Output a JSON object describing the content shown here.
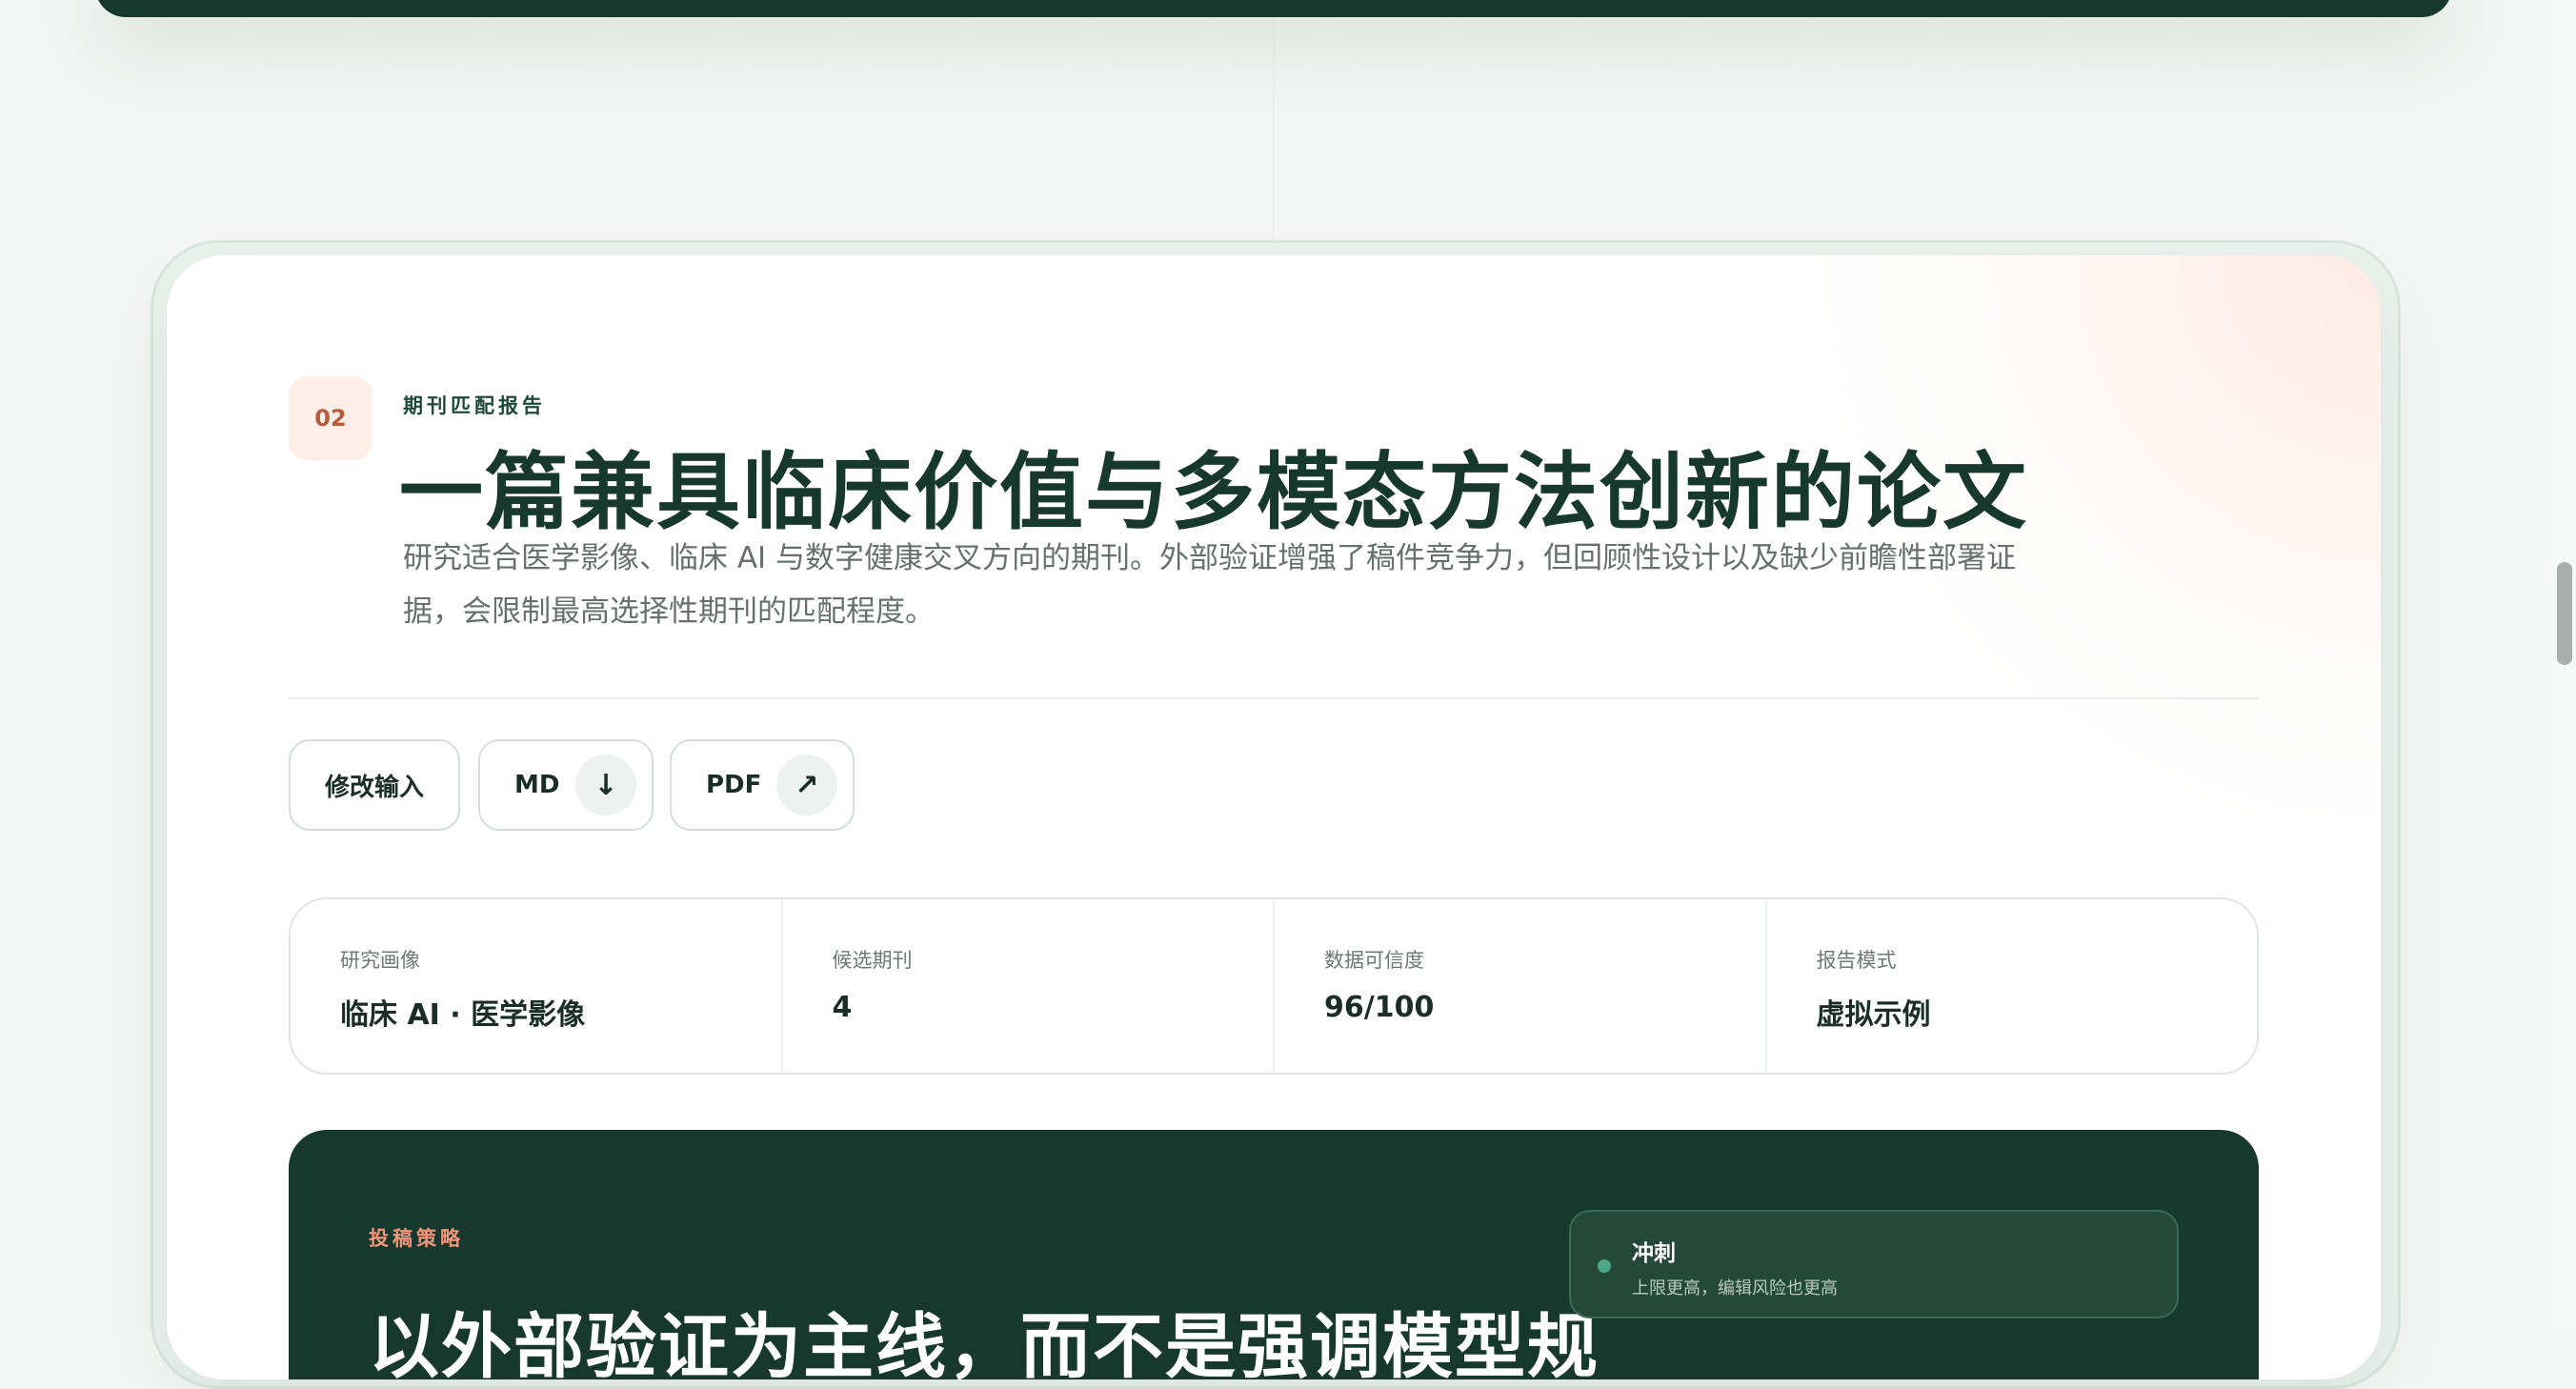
{
  "section": {
    "number": "02",
    "kicker": "期刊匹配报告",
    "title": "一篇兼具临床价值与多模态方法创新的论文",
    "description": "研究适合医学影像、临床 AI 与数字健康交叉方向的期刊。外部验证增强了稿件竞争力，但回顾性设计以及缺少前瞻性部署证据，会限制最高选择性期刊的匹配程度。"
  },
  "actions": {
    "edit_label": "修改输入",
    "md_label": "MD",
    "md_icon": "download-arrow-icon",
    "md_icon_glyph": "↓",
    "pdf_label": "PDF",
    "pdf_icon": "external-arrow-icon",
    "pdf_icon_glyph": "↗"
  },
  "stats": [
    {
      "label": "研究画像",
      "value": "临床 AI · 医学影像"
    },
    {
      "label": "候选期刊",
      "value": "4"
    },
    {
      "label": "数据可信度",
      "value": "96/100"
    },
    {
      "label": "报告模式",
      "value": "虚拟示例"
    }
  ],
  "strategy": {
    "kicker": "投稿策略",
    "title": "以外部验证为主线，而不是强调模型规",
    "tier": {
      "name": "冲刺",
      "description": "上限更高，编辑风险也更高"
    }
  },
  "colors": {
    "brand_dark": "#17392d",
    "accent_coral": "#f0957a",
    "badge_bg": "#fdeee8",
    "tier_dot": "#4fa889"
  }
}
